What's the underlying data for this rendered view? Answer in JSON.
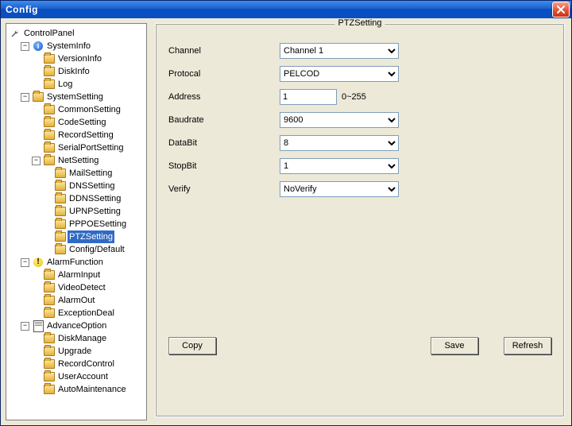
{
  "window": {
    "title": "Config"
  },
  "tree": {
    "root": "ControlPanel",
    "systemInfo": {
      "label": "SystemInfo",
      "children": {
        "version": "VersionInfo",
        "disk": "DiskInfo",
        "log": "Log"
      }
    },
    "systemSetting": {
      "label": "SystemSetting",
      "common": "CommonSetting",
      "code": "CodeSetting",
      "record": "RecordSetting",
      "serial": "SerialPortSetting",
      "netSetting": {
        "label": "NetSetting",
        "mail": "MailSetting",
        "dns": "DNSSetting",
        "ddns": "DDNSSetting",
        "upnp": "UPNPSetting",
        "pppoe": "PPPOESetting",
        "ptz": "PTZSetting",
        "configDefault": "Config/Default"
      }
    },
    "alarmFunction": {
      "label": "AlarmFunction",
      "input": "AlarmInput",
      "video": "VideoDetect",
      "out": "AlarmOut",
      "exception": "ExceptionDeal"
    },
    "advanceOption": {
      "label": "AdvanceOption",
      "disk": "DiskManage",
      "upgrade": "Upgrade",
      "recordControl": "RecordControl",
      "userAccount": "UserAccount",
      "autoMaint": "AutoMaintenance"
    }
  },
  "panel": {
    "title": "PTZSetting",
    "labels": {
      "channel": "Channel",
      "protocol": "Protocal",
      "address": "Address",
      "addressHint": "0~255",
      "baudrate": "Baudrate",
      "databit": "DataBit",
      "stopbit": "StopBit",
      "verify": "Verify"
    },
    "values": {
      "channel": "Channel 1",
      "protocol": "PELCOD",
      "address": "1",
      "baudrate": "9600",
      "databit": "8",
      "stopbit": "1",
      "verify": "NoVerify"
    },
    "buttons": {
      "copy": "Copy",
      "save": "Save",
      "refresh": "Refresh"
    }
  }
}
